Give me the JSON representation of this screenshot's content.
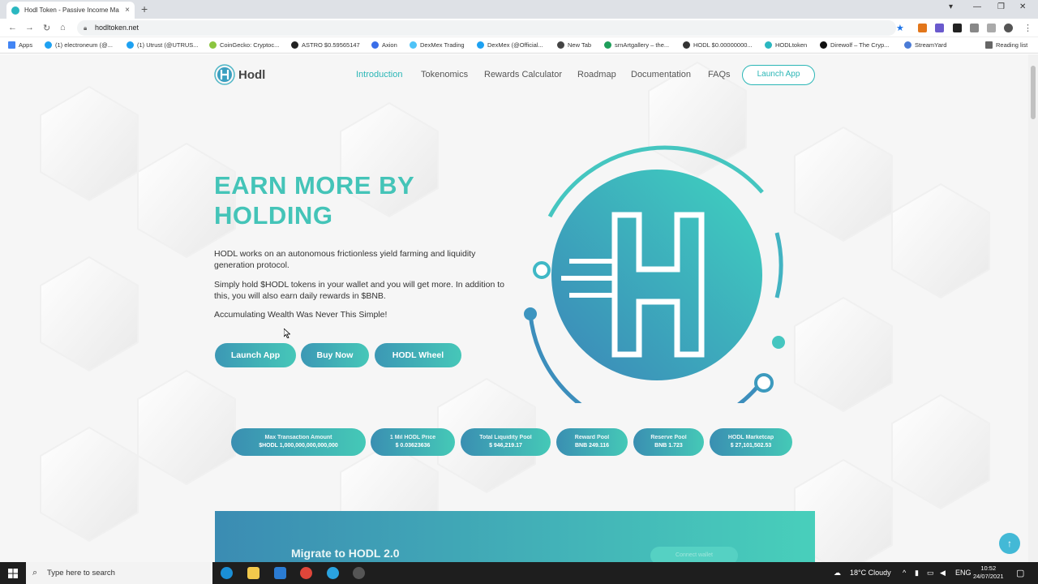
{
  "browser": {
    "tab_title": "Hodl Token - Passive Income Ma",
    "tab_close": "×",
    "new_tab": "+",
    "url": "hodltoken.net",
    "bookmarks": [
      {
        "label": "Apps",
        "color": "#4285f4"
      },
      {
        "label": "(1) electroneum (@...",
        "color": "#1da1f2"
      },
      {
        "label": "(1) Utrust (@UTRUS...",
        "color": "#1da1f2"
      },
      {
        "label": "CoinGecko: Cryptoc...",
        "color": "#8bc53f"
      },
      {
        "label": "ASTRO $0.59565147",
        "color": "#222222"
      },
      {
        "label": "Axion",
        "color": "#3a6ee8"
      },
      {
        "label": "DexMex Trading",
        "color": "#4fc3f7"
      },
      {
        "label": "DexMex (@Official...",
        "color": "#1da1f2"
      },
      {
        "label": "New Tab",
        "color": "#444444"
      },
      {
        "label": "srnArtgallery – the...",
        "color": "#1e9e5a"
      },
      {
        "label": "HODL $0.00000000...",
        "color": "#333333"
      },
      {
        "label": "HODLtoken",
        "color": "#2ab7c0"
      },
      {
        "label": "Direwolf – The Cryp...",
        "color": "#111111"
      },
      {
        "label": "StreamYard",
        "color": "#4a7bd6"
      },
      {
        "label": "Reading list",
        "color": "#666666"
      }
    ]
  },
  "site": {
    "logo_text": "Hodl",
    "nav": [
      {
        "label": "Introduction",
        "active": true
      },
      {
        "label": "Tokenomics",
        "active": false
      },
      {
        "label": "Rewards Calculator",
        "active": false
      },
      {
        "label": "Roadmap",
        "active": false
      },
      {
        "label": "Documentation",
        "active": false
      },
      {
        "label": "FAQs",
        "active": false
      }
    ],
    "launch_app_top": "Launch App",
    "hero": {
      "title": "EARN MORE BY HOLDING",
      "p1": "HODL works on an autonomous frictionless yield farming and liquidity generation protocol.",
      "p2": "Simply hold $HODL tokens in your wallet and you will get more. In addition to this, you will also earn daily rewards in $BNB.",
      "p3": "Accumulating Wealth Was Never This Simple!",
      "buttons": [
        "Launch App",
        "Buy Now",
        "HODL Wheel"
      ]
    },
    "stats": [
      {
        "label": "Max Transaction Amount",
        "value": "$HODL 1,000,000,000,000,000"
      },
      {
        "label": "1 Mil HODL Price",
        "value": "$ 0.03623636"
      },
      {
        "label": "Total Liquidity Pool",
        "value": "$ 946,219.17"
      },
      {
        "label": "Reward Pool",
        "value": "BNB 249.116"
      },
      {
        "label": "Reserve Pool",
        "value": "BNB 1.723"
      },
      {
        "label": "HODL Marketcap",
        "value": "$ 27,101,502.53"
      }
    ],
    "migrate_title": "Migrate to HODL 2.0",
    "connect_wallet": "Connect wallet",
    "to_top": "↑"
  },
  "taskbar": {
    "search_placeholder": "Type here to search",
    "weather": "18°C  Cloudy",
    "lang": "ENG",
    "time": "10:52",
    "date": "24/07/2021"
  },
  "colors": {
    "accent": "#2bb6b6",
    "gradient_start": "#3a8fb2",
    "gradient_end": "#45c9b7"
  }
}
